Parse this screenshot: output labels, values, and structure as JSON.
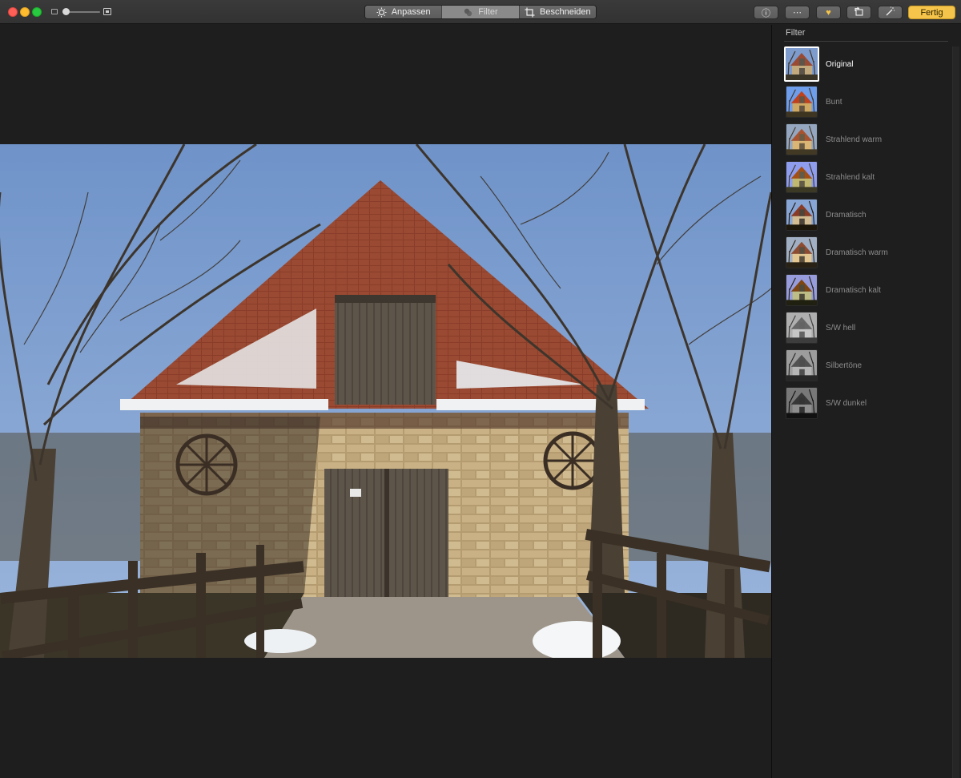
{
  "toolbar": {
    "segments": [
      {
        "label": "Anpassen",
        "icon": "adjust-sun-icon",
        "active": false
      },
      {
        "label": "Filter",
        "icon": "filter-circles-icon",
        "active": true
      },
      {
        "label": "Beschneiden",
        "icon": "crop-icon",
        "active": false
      }
    ],
    "right_buttons": [
      {
        "icon": "info-icon",
        "glyph": "ⓘ"
      },
      {
        "icon": "more-icon",
        "glyph": "⋯"
      },
      {
        "icon": "heart-icon",
        "glyph": "♥",
        "color": "#f5c44a"
      },
      {
        "icon": "rotate-icon",
        "glyph": "⟲"
      },
      {
        "icon": "magic-wand-icon",
        "glyph": "⁂"
      }
    ],
    "done_label": "Fertig"
  },
  "zoom": {
    "value_fraction": 0.05
  },
  "sidebar": {
    "title": "Filter",
    "filters": [
      {
        "label": "Original",
        "selected": true,
        "tint": "none"
      },
      {
        "label": "Bunt",
        "selected": false,
        "tint": "vivid"
      },
      {
        "label": "Strahlend warm",
        "selected": false,
        "tint": "warm"
      },
      {
        "label": "Strahlend kalt",
        "selected": false,
        "tint": "cool"
      },
      {
        "label": "Dramatisch",
        "selected": false,
        "tint": "dramatic"
      },
      {
        "label": "Dramatisch warm",
        "selected": false,
        "tint": "dramatic-warm"
      },
      {
        "label": "Dramatisch kalt",
        "selected": false,
        "tint": "dramatic-cool"
      },
      {
        "label": "S/W hell",
        "selected": false,
        "tint": "mono-light"
      },
      {
        "label": "Silbertöne",
        "selected": false,
        "tint": "silver"
      },
      {
        "label": "S/W dunkel",
        "selected": false,
        "tint": "mono-dark"
      }
    ]
  },
  "colors": {
    "accent": "#f5c44a",
    "background": "#1e1e1e",
    "selected_text": "#ffffff",
    "label_text": "#8c8c8c"
  }
}
